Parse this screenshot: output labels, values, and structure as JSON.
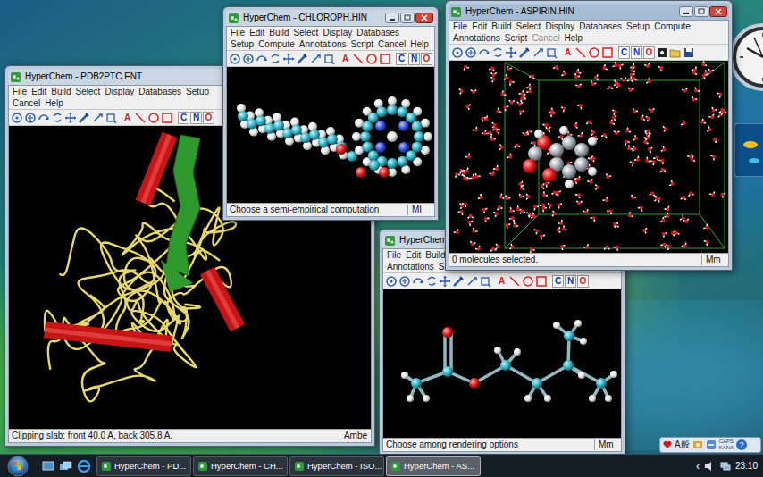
{
  "windows": [
    {
      "title": "HyperChem - PDB2PTC.ENT",
      "active": false,
      "menu_rows": [
        [
          {
            "label": "File",
            "disabled": false
          },
          {
            "label": "Edit",
            "disabled": false
          },
          {
            "label": "Build",
            "disabled": false
          },
          {
            "label": "Select",
            "disabled": false
          },
          {
            "label": "Display",
            "disabled": false
          },
          {
            "label": "Databases",
            "disabled": false
          },
          {
            "label": "Setup",
            "disabled": false
          }
        ],
        [
          {
            "label": "Cancel",
            "disabled": false
          },
          {
            "label": "Help",
            "disabled": false
          }
        ]
      ],
      "toolbar_letters": [
        {
          "text": "A",
          "color": "#e02020"
        },
        {
          "text": "C",
          "color": "#1030c0"
        },
        {
          "text": "N",
          "color": "#1030c0"
        },
        {
          "text": "O",
          "color": "#e02020"
        }
      ],
      "status": {
        "message": "Clipping slab: front 40.0 A, back 305.8 A.",
        "mode": "Ambe"
      }
    },
    {
      "title": "HyperChem - CHLOROPH.HIN",
      "active": false,
      "menu_rows": [
        [
          {
            "label": "File",
            "disabled": false
          },
          {
            "label": "Edit",
            "disabled": false
          },
          {
            "label": "Build",
            "disabled": false
          },
          {
            "label": "Select",
            "disabled": false
          },
          {
            "label": "Display",
            "disabled": false
          },
          {
            "label": "Databases",
            "disabled": false
          }
        ],
        [
          {
            "label": "Setup",
            "disabled": false
          },
          {
            "label": "Compute",
            "disabled": false
          },
          {
            "label": "Annotations",
            "disabled": false
          },
          {
            "label": "Script",
            "disabled": false
          },
          {
            "label": "Cancel",
            "disabled": false
          },
          {
            "label": "Help",
            "disabled": false
          }
        ]
      ],
      "toolbar_letters": [
        {
          "text": "A",
          "color": "#e02020"
        },
        {
          "text": "C",
          "color": "#1030c0"
        },
        {
          "text": "N",
          "color": "#1030c0"
        },
        {
          "text": "O",
          "color": "#e02020"
        }
      ],
      "status": {
        "message": "Choose a semi-empirical computation",
        "mode": "MI"
      }
    },
    {
      "title": "HyperChem -",
      "active": false,
      "menu_rows": [
        [
          {
            "label": "File",
            "disabled": false
          },
          {
            "label": "Edit",
            "disabled": false
          },
          {
            "label": "Build",
            "disabled": false
          }
        ],
        [
          {
            "label": "Annotations",
            "disabled": false
          },
          {
            "label": "S",
            "disabled": false
          }
        ]
      ],
      "toolbar_letters": [
        {
          "text": "A",
          "color": "#e02020"
        },
        {
          "text": "C",
          "color": "#1030c0"
        },
        {
          "text": "N",
          "color": "#1030c0"
        },
        {
          "text": "O",
          "color": "#e02020"
        }
      ],
      "status": {
        "message": "Choose among rendering options",
        "mode": "Mm"
      }
    },
    {
      "title": "HyperChem - ASPIRIN.HIN",
      "active": true,
      "menu_rows": [
        [
          {
            "label": "File",
            "disabled": false
          },
          {
            "label": "Edit",
            "disabled": false
          },
          {
            "label": "Build",
            "disabled": false
          },
          {
            "label": "Select",
            "disabled": false
          },
          {
            "label": "Display",
            "disabled": false
          },
          {
            "label": "Databases",
            "disabled": false
          },
          {
            "label": "Setup",
            "disabled": false
          },
          {
            "label": "Compute",
            "disabled": false
          }
        ],
        [
          {
            "label": "Annotations",
            "disabled": false
          },
          {
            "label": "Script",
            "disabled": false
          },
          {
            "label": "Cancel",
            "disabled": true
          },
          {
            "label": "Help",
            "disabled": false
          }
        ]
      ],
      "toolbar_letters": [
        {
          "text": "A",
          "color": "#e02020"
        },
        {
          "text": "C",
          "color": "#1030c0"
        },
        {
          "text": "N",
          "color": "#1030c0"
        },
        {
          "text": "O",
          "color": "#e02020"
        }
      ],
      "status": {
        "message": "0 molecules selected.",
        "mode": "Mm"
      }
    }
  ],
  "language_bar": {
    "ime": "A般",
    "caps": "CAPS",
    "kana": "KANA",
    "help": "?"
  },
  "taskbar": {
    "tasks": [
      {
        "label": "HyperChem - PD...",
        "selected": false
      },
      {
        "label": "HyperChem - CH...",
        "selected": false
      },
      {
        "label": "HyperChem - ISO...",
        "selected": false
      },
      {
        "label": "HyperChem - AS...",
        "selected": true
      }
    ],
    "tray": {
      "chevron": "‹",
      "time": "23:10"
    }
  }
}
